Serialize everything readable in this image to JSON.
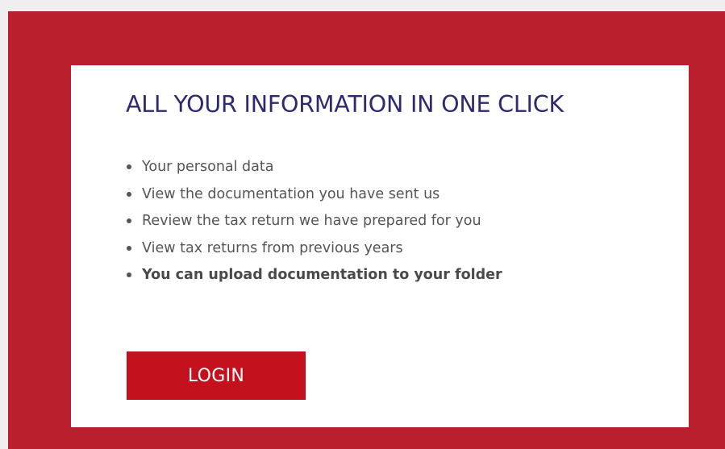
{
  "card": {
    "title": "ALL YOUR INFORMATION IN ONE CLICK",
    "features": [
      "Your personal data",
      "View the documentation you have sent us",
      "Review the tax return we have prepared for you",
      "View tax returns from previous years",
      "You can upload documentation to your folder"
    ],
    "login_label": "LOGIN"
  },
  "colors": {
    "background": "#efefef",
    "brand_red": "#b91f2c",
    "button_red": "#c3121e",
    "title_navy": "#2d2a6e",
    "text_gray": "#555555"
  }
}
